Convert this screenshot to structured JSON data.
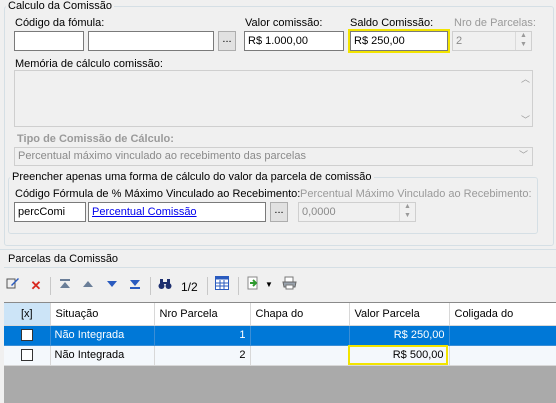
{
  "calculo": {
    "legend": "Calculo da Comissão",
    "codigo_formula_label": "Código da fómula:",
    "codigo_formula_value": "",
    "codigo_formula_desc": "",
    "ellipsis": "...",
    "valor_comissao_label": "Valor comissão:",
    "valor_comissao_value": "R$ 1.000,00",
    "saldo_comissao_label": "Saldo Comissão:",
    "saldo_comissao_value": "R$ 250,00",
    "nro_parcelas_label": "Nro de Parcelas:",
    "nro_parcelas_value": "2",
    "memoria_label": "Memória de cálculo comissão:",
    "memoria_value": "",
    "tipo_label": "Tipo de Comissão de Cálculo:",
    "tipo_value": "Percentual máximo vinculado ao recebimento das parcelas",
    "preencher": {
      "legend": "Preencher apenas uma forma de cálculo do valor da parcela de comissão",
      "codigo_label": "Código Fórmula de % Máximo Vinculado ao Recebimento:",
      "codigo_value": "percComi",
      "codigo_link": "Percentual Comissão",
      "ellipsis": "...",
      "percentual_label": "Percentual Máximo Vinculado ao Recebimento:",
      "percentual_value": "0,0000"
    }
  },
  "parcelas": {
    "title": "Parcelas da Comissão",
    "page_indicator": "1/2",
    "columns": [
      "[x]",
      "Situação",
      "Nro Parcela",
      "Chapa do",
      "Valor Parcela",
      "Coligada do"
    ],
    "rows": [
      {
        "situacao": "Não Integrada",
        "nro": "1",
        "chapa": "",
        "valor": "R$ 250,00",
        "coligada": ""
      },
      {
        "situacao": "Não Integrada",
        "nro": "2",
        "chapa": "",
        "valor": "R$ 500,00",
        "coligada": ""
      }
    ]
  },
  "colors": {
    "highlight": "#f2e400",
    "selected_row": "#0078d7",
    "grid_background": "#aaaaaa"
  },
  "icons": {
    "edit": "edit-icon",
    "delete": "delete-icon",
    "first": "first-record-icon",
    "prev": "previous-record-icon",
    "next": "next-record-icon",
    "last": "last-record-icon",
    "find": "binoculars-icon",
    "grid": "grid-view-icon",
    "process": "process-icon",
    "print": "print-icon"
  }
}
